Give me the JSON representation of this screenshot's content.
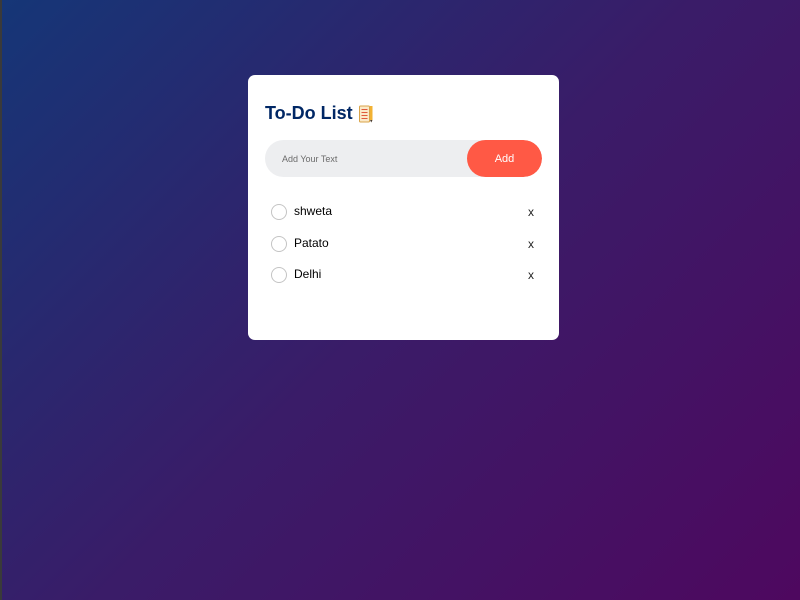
{
  "header": {
    "title": "To-Do List",
    "icon": "notepad-pencil-icon"
  },
  "input": {
    "placeholder": "Add Your Text",
    "value": ""
  },
  "buttons": {
    "add_label": "Add"
  },
  "todos": [
    {
      "text": "shweta",
      "checked": false,
      "delete_label": "x"
    },
    {
      "text": "Patato",
      "checked": false,
      "delete_label": "x"
    },
    {
      "text": "Delhi",
      "checked": false,
      "delete_label": "x"
    }
  ],
  "colors": {
    "accent": "#ff5945",
    "title": "#002765",
    "bg_start": "#153677",
    "bg_end": "#4e085f",
    "input_bg": "#edeef0"
  }
}
